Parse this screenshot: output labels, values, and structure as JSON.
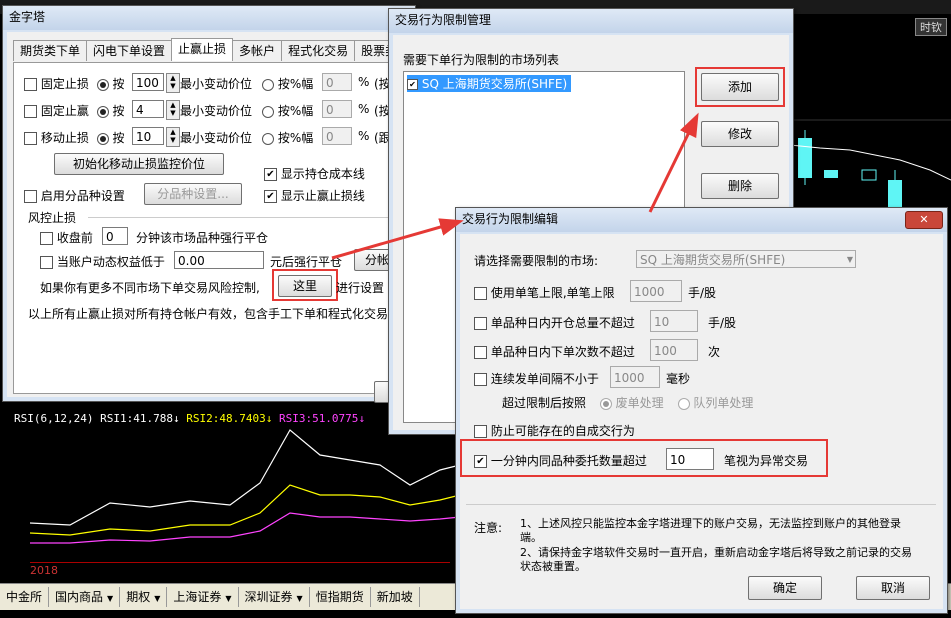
{
  "app": {
    "top_right_text": "时钦",
    "rsi": {
      "label": "RSI(6,12,24)",
      "rsi1": "RSI1:41.788",
      "rsi2": "RSI2:48.7403",
      "rsi3": "RSI3:51.0775"
    },
    "year_label": "2018"
  },
  "bottom_tabs": [
    {
      "label": "中金所",
      "dd": ""
    },
    {
      "label": "国内商品",
      "dd": "▼"
    },
    {
      "label": "期权",
      "dd": "▼"
    },
    {
      "label": "上海证券",
      "dd": "▼"
    },
    {
      "label": "深圳证券",
      "dd": "▼"
    },
    {
      "label": "恒指期货",
      "dd": ""
    },
    {
      "label": "新加坡",
      "dd": ""
    }
  ],
  "settings_window": {
    "title": "金字塔",
    "tabs": [
      "期货类下单",
      "闪电下单设置",
      "止赢止损",
      "多帐户",
      "程式化交易",
      "股票类"
    ],
    "fixed_stop_loss": {
      "label": "固定止损",
      "by": "按",
      "value": "100",
      "unit": "最小变动价位",
      "pct_label": "按%幅",
      "pct_value": "0",
      "pct": "%",
      "tail": "(按"
    },
    "fixed_take_profit": {
      "label": "固定止赢",
      "by": "按",
      "value": "4",
      "unit": "最小变动价位",
      "pct_label": "按%幅",
      "pct_value": "0",
      "pct": "%",
      "tail": "(按"
    },
    "trailing_stop": {
      "label": "移动止损",
      "by": "按",
      "value": "10",
      "unit": "最小变动价位",
      "pct_label": "按%幅",
      "pct_value": "0",
      "pct": "%",
      "tail": "(跟"
    },
    "init_trailing_button": "初始化移动止损监控价位",
    "show_cost_line": "显示持仓成本线",
    "enable_per_symbol": "启用分品种设置",
    "per_symbol_button": "分品种设置...",
    "show_tp_sl_line": "显示止赢止损线",
    "risk_section": "风控止损",
    "close_before": {
      "label": "收盘前",
      "value": "0",
      "suffix": "分钟该市场品种强行平仓"
    },
    "equity_below": {
      "label": "当账户动态权益低于",
      "value": "0.00",
      "suffix": "元后强行平仓",
      "button": "分帐"
    },
    "more_markets_text": "如果你有更多不同市场下单交易风险控制,",
    "here_button": "这里",
    "run_settings": "进行设置",
    "footer_text": "以上所有止赢止损对所有持仓帐户有效，包含手工下单和程式化交易"
  },
  "market_window": {
    "title": "交易行为限制管理",
    "list_label": "需要下单行为限制的市场列表",
    "items": [
      {
        "label": "SQ 上海期货交易所(SHFE)",
        "checked": "✔"
      }
    ],
    "add_button": "添加",
    "edit_button": "修改",
    "delete_button": "删除"
  },
  "edit_window": {
    "title": "交易行为限制编辑",
    "market_label": "请选择需要限制的市场:",
    "market_value": "SQ 上海期货交易所(SHFE)",
    "order_limit": {
      "label": "使用单笔上限,单笔上限",
      "value": "1000",
      "unit": "手/股"
    },
    "open_limit": {
      "label": "单品种日内开仓总量不超过",
      "value": "10",
      "unit": "手/股"
    },
    "order_count": {
      "label": "单品种日内下单次数不超过",
      "value": "100",
      "unit": "次"
    },
    "interval": {
      "label": "连续发单间隔不小于",
      "value": "1000",
      "unit": "毫秒"
    },
    "over_limit_label": "超过限制后按照",
    "opt_discard": "废单处理",
    "opt_queue": "队列单处理",
    "self_trade": "防止可能存在的自成交行为",
    "per_minute": {
      "label": "一分钟内同品种委托数量超过",
      "value": "10",
      "suffix": "笔视为异常交易",
      "checked": "✔"
    },
    "note_label": "注意:",
    "note1": "1、上述风控只能监控本金字塔进理下的账户交易，无法监控到账户的其他登录端。",
    "note2": "2、请保持金字塔软件交易时一直开启，重新启动金字塔后将导致之前记录的交易状态被重置。",
    "ok_button": "确定",
    "cancel_button": "取消"
  },
  "colors": {
    "accent_red": "#e53935",
    "rsi1": "#ffffff",
    "rsi2": "#ffff00",
    "rsi3": "#ff44ff",
    "candle": "#5ff5f5"
  }
}
